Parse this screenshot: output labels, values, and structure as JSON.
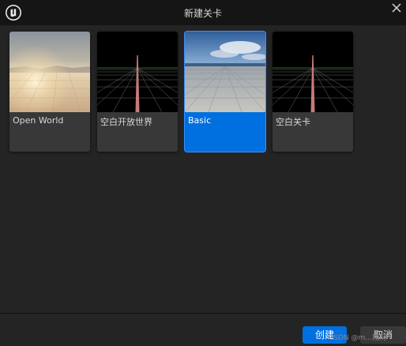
{
  "window": {
    "title": "新建关卡",
    "logo_icon": "unreal-engine-logo-icon",
    "close_icon": "close-icon"
  },
  "templates": [
    {
      "label": "Open World",
      "thumbnail": "open-world-desert-thumbnail",
      "selected": false
    },
    {
      "label": "空白开放世界",
      "thumbnail": "empty-grid-thumbnail",
      "selected": false
    },
    {
      "label": "Basic",
      "thumbnail": "basic-tiled-floor-sky-thumbnail",
      "selected": true
    },
    {
      "label": "空白关卡",
      "thumbnail": "empty-grid-thumbnail",
      "selected": false
    }
  ],
  "footer": {
    "create_label": "创建",
    "cancel_label": "取消"
  },
  "watermark": "CSDN @m…刚网",
  "colors": {
    "accent": "#0070e0",
    "background": "#242424",
    "titlebar": "#151515",
    "card": "#383838"
  }
}
